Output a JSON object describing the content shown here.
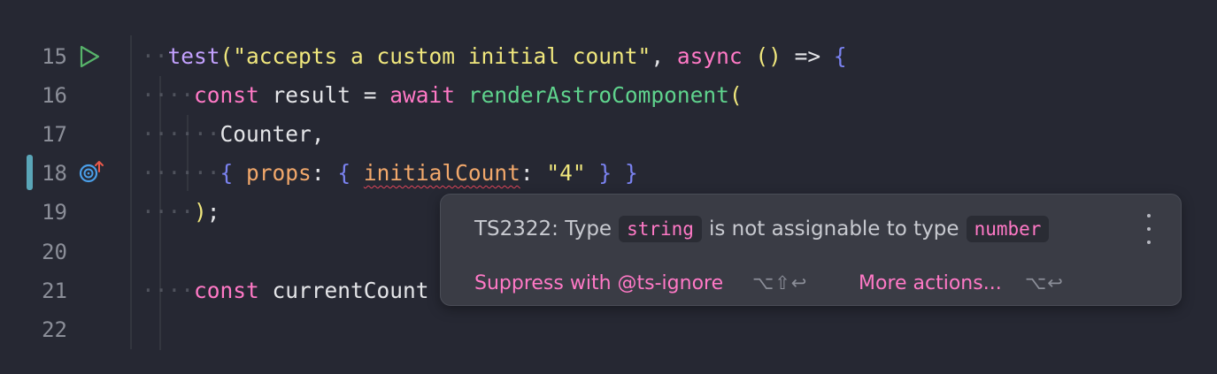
{
  "editor": {
    "line_numbers": [
      "15",
      "16",
      "17",
      "18",
      "19",
      "20",
      "21",
      "22"
    ],
    "gutter_icons": {
      "line15": "run-test-icon",
      "line18": "target-icon"
    },
    "lines": {
      "l15": {
        "ws": "··",
        "fn": "test",
        "open": "(",
        "str": "\"accepts a custom initial count\"",
        "comma": ", ",
        "kw": "async",
        "sp": " ",
        "parens": "()",
        "arrow": " => ",
        "brace": "{"
      },
      "l16": {
        "ws": "····",
        "kw1": "const",
        "ident": " result = ",
        "kw2": "await",
        "sp": " ",
        "call": "renderAstroComponent",
        "open": "("
      },
      "l17": {
        "ws": "······",
        "ident": "Counter,"
      },
      "l18": {
        "ws": "······",
        "b1": "{",
        "sp1": " ",
        "prop1": "props",
        "colon1": ": ",
        "b2": "{",
        "sp2": " ",
        "prop2": "initialCount",
        "colon2": ": ",
        "str": "\"4\"",
        "sp3": " ",
        "b3": "}",
        "sp4": " ",
        "b4": "}"
      },
      "l19": {
        "ws": "····",
        "paren": ")",
        "semi": ";"
      },
      "l21": {
        "ws": "····",
        "kw": "const",
        "ident": " currentCount"
      }
    }
  },
  "popup": {
    "message_prefix": "TS2322: Type",
    "type_from": "string",
    "message_middle": "is not assignable to type",
    "type_to": "number",
    "actions": [
      {
        "label": "Suppress with @ts-ignore",
        "shortcut": "⌥⇧↩"
      },
      {
        "label": "More actions...",
        "shortcut": "⌥↩"
      }
    ],
    "menu_icon": "more-vertical-icon"
  },
  "colors": {
    "background": "#262833",
    "popup_background": "#3a3c45",
    "keyword": "#ff79c6",
    "string": "#f0e77d",
    "function": "#c3a1ff",
    "call": "#5fd38d",
    "property": "#f2a86b",
    "brace": "#7a82f0",
    "error_underline": "#e0455a",
    "change_marker": "#5aa6b8"
  }
}
